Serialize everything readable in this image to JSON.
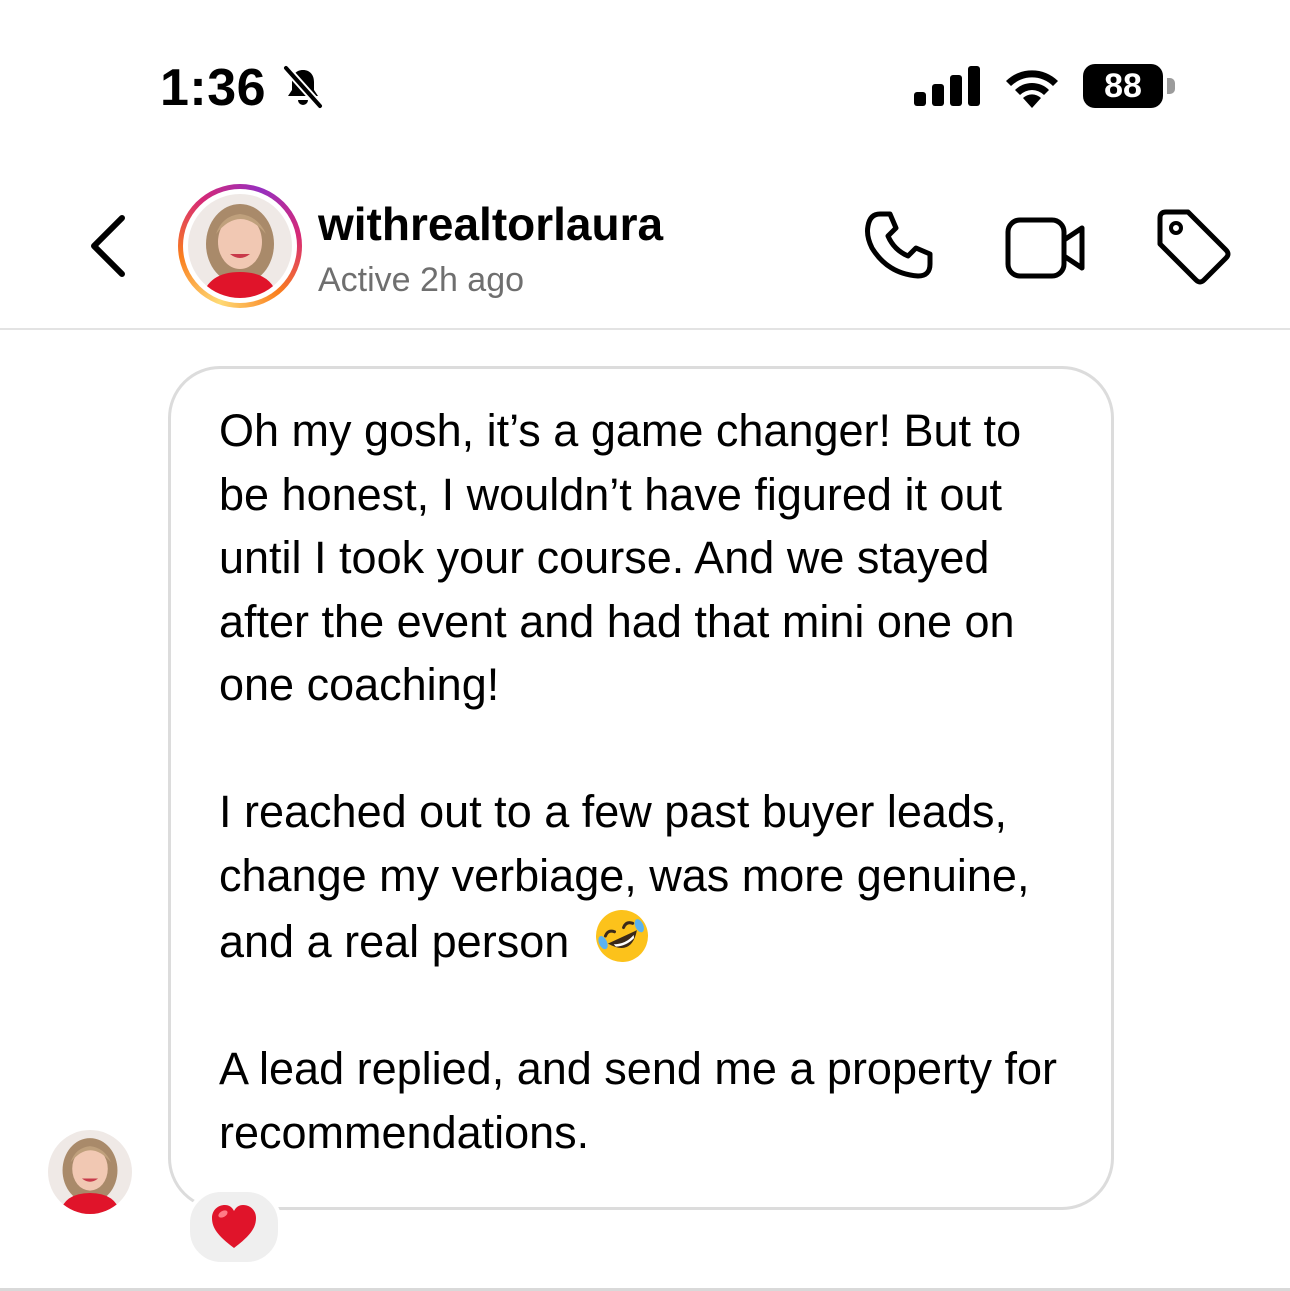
{
  "status_bar": {
    "time": "1:36",
    "battery": "88"
  },
  "header": {
    "username": "withrealtorlaura",
    "active_status": "Active 2h ago"
  },
  "message": {
    "paragraphs": [
      "Oh my gosh, it’s a game changer! But to be honest, I wouldn’t have figured it out until I took your course. And we stayed after the event and had that mini one on one coaching!",
      "I reached out to a few past buyer leads, change my verbiage, was more genuine, and a real person",
      "A lead replied, and send me a property for recommendations."
    ],
    "emoji": "rolling-on-floor-laughing-emoji",
    "reaction": "red-heart"
  },
  "colors": {
    "bubble_border": "#dcdcdc",
    "secondary_text": "#6f6f6f",
    "reaction_bg": "#efefef",
    "heart": "#e0142a"
  }
}
